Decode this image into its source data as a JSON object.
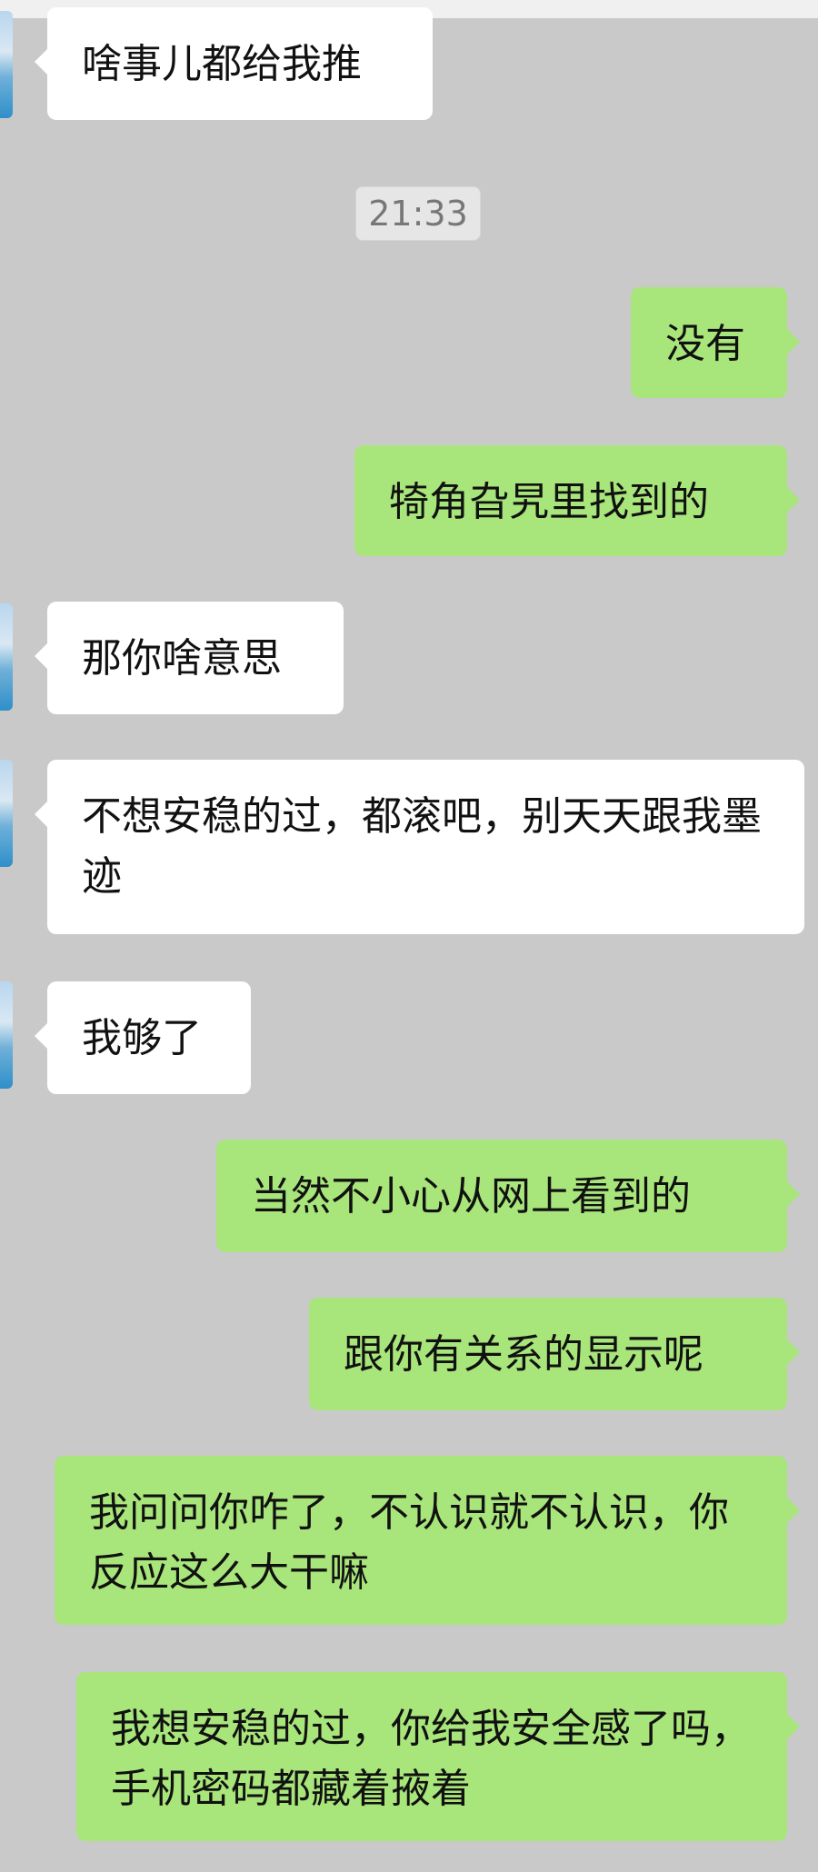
{
  "timestamp": "21:33",
  "messages": [
    {
      "side": "left",
      "text": "啥事儿都给我推"
    },
    {
      "side": "right",
      "text": "没有"
    },
    {
      "side": "right",
      "text": "犄角旮旯里找到的"
    },
    {
      "side": "left",
      "text": "那你啥意思"
    },
    {
      "side": "left",
      "text": "不想安稳的过，都滚吧，别天天跟我墨迹"
    },
    {
      "side": "left",
      "text": "我够了"
    },
    {
      "side": "right",
      "text": "当然不小心从网上看到的"
    },
    {
      "side": "right",
      "text": "跟你有关系的显示呢"
    },
    {
      "side": "right",
      "text": "我问问你咋了，不认识就不认识，你反应这么大干嘛"
    },
    {
      "side": "right",
      "text": "我想安稳的过，你给我安全感了吗，手机密码都藏着掖着"
    }
  ]
}
